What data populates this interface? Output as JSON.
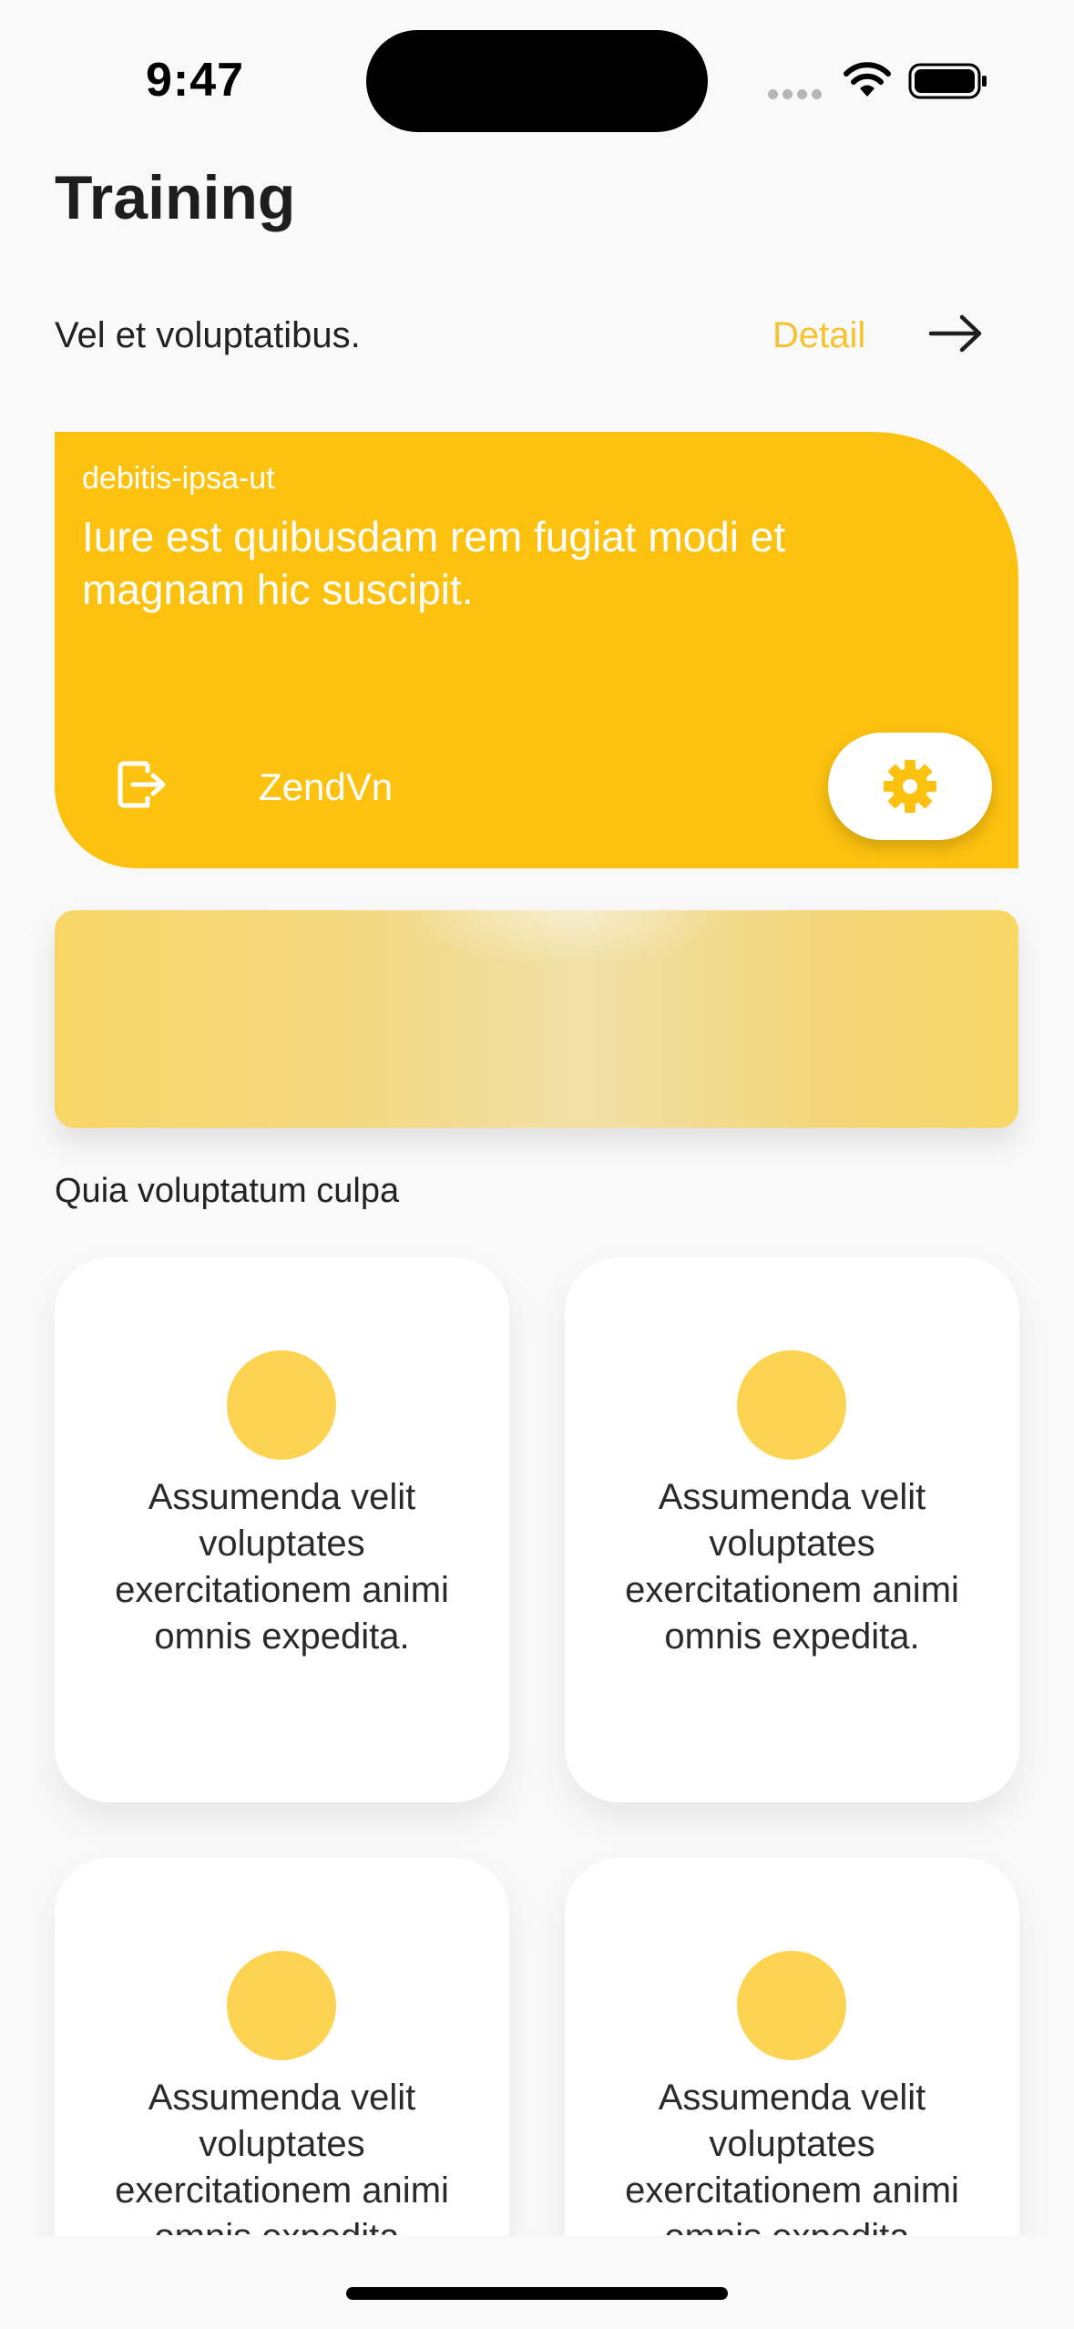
{
  "status_bar": {
    "time": "9:47"
  },
  "header": {
    "title": "Training",
    "subtitle": "Vel et voluptatibus.",
    "detail_label": "Detail"
  },
  "feature_card": {
    "tag": "debitis-ipsa-ut",
    "text": "Iure est quibusdam rem fugiat modi et magnam hic suscipit.",
    "brand_label": "ZendVn",
    "color": "#fdc20f"
  },
  "section": {
    "title": "Quia voluptatum culpa"
  },
  "grid_cards": [
    {
      "text": "Assumenda velit voluptates exercitationem animi omnis expedita."
    },
    {
      "text": "Assumenda velit voluptates exercitationem animi omnis expedita."
    },
    {
      "text": "Assumenda velit voluptates exercitationem animi omnis expedita."
    },
    {
      "text": "Assumenda velit voluptates exercitationem animi omnis expedita."
    }
  ],
  "icons": {
    "arrow": "arrow-right-icon",
    "brand": "exit-icon",
    "settings": "gear-icon"
  },
  "colors": {
    "accent": "#f7c22d",
    "dot": "#fdd452",
    "background": "#f9f9f9"
  }
}
